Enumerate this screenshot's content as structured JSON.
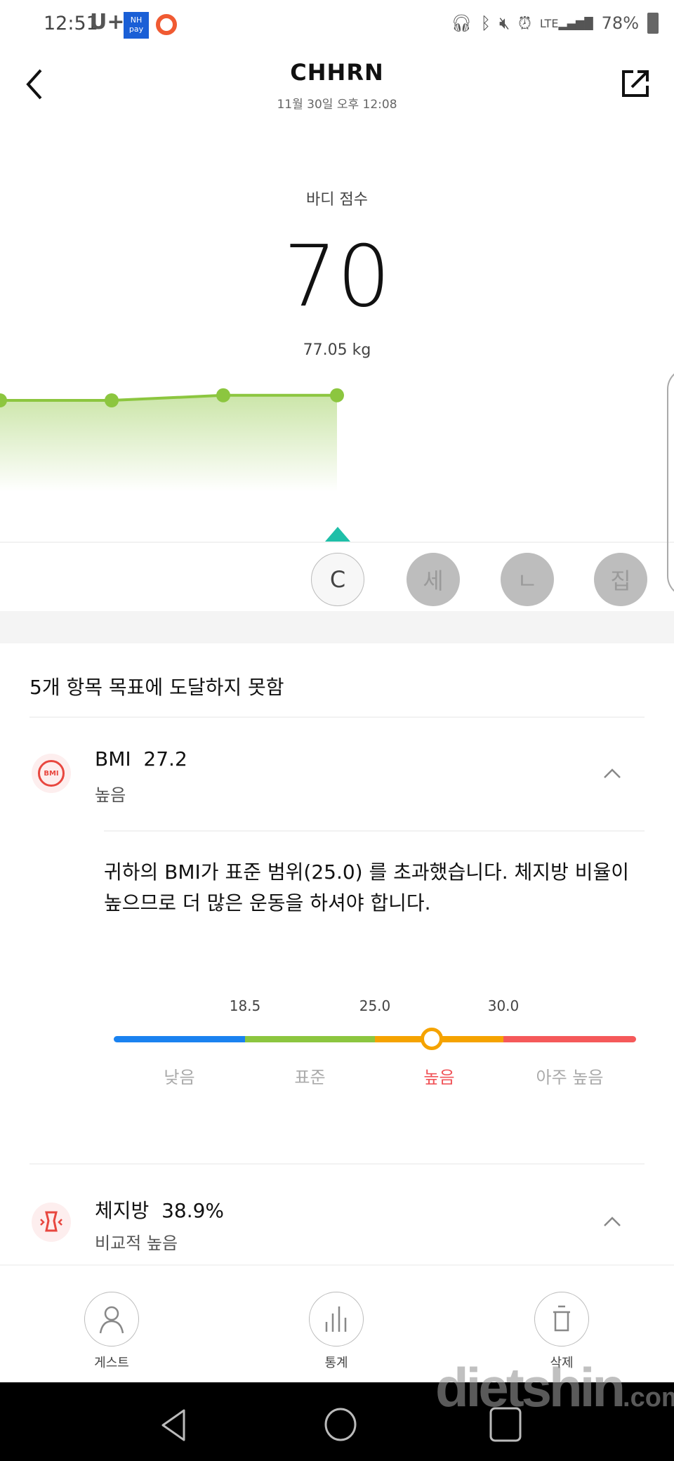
{
  "status_bar": {
    "time": "12:51",
    "carrier": "U+",
    "nh_pay": "NH pay",
    "battery": "78%"
  },
  "header": {
    "title": "CHHRN",
    "date": "11월 30일 오후 12:08"
  },
  "score": {
    "label": "바디 점수",
    "value": "70",
    "weight": "77.05 kg"
  },
  "trend_chart": {
    "type": "line",
    "color": "#8cc63f",
    "values": [
      70,
      70,
      70.3,
      70.3
    ]
  },
  "users": [
    {
      "label": "C",
      "active": true
    },
    {
      "label": "세",
      "active": false
    },
    {
      "label": "ㄴ",
      "active": false
    },
    {
      "label": "집",
      "active": false
    }
  ],
  "goal_summary": "5개 항목 목표에 도달하지 못함",
  "bmi": {
    "icon_text": "BMI",
    "title": "BMI  27.2",
    "value": 27.2,
    "status": "높음",
    "description": "귀하의 BMI가 표준 범위(25.0) 를 초과했습니다. 체지방 비율이 높으므로 더 많은 운동을 하셔야 합니다.",
    "ticks": [
      "18.5",
      "25.0",
      "30.0"
    ],
    "categories": [
      {
        "label": "낮음",
        "color": "#1a82f0"
      },
      {
        "label": "표준",
        "color": "#8cc63f"
      },
      {
        "label": "높음",
        "color": "#f5a300"
      },
      {
        "label": "아주 높음",
        "color": "#f5595a"
      }
    ],
    "current_category": "높음"
  },
  "body_fat": {
    "title": "체지방  38.9%",
    "status": "비교적 높음"
  },
  "bottom_actions": [
    {
      "label": "게스트",
      "icon": "person-icon"
    },
    {
      "label": "통계",
      "icon": "bar-chart-icon"
    },
    {
      "label": "삭제",
      "icon": "trash-icon"
    }
  ],
  "watermark": "dietshin.com"
}
